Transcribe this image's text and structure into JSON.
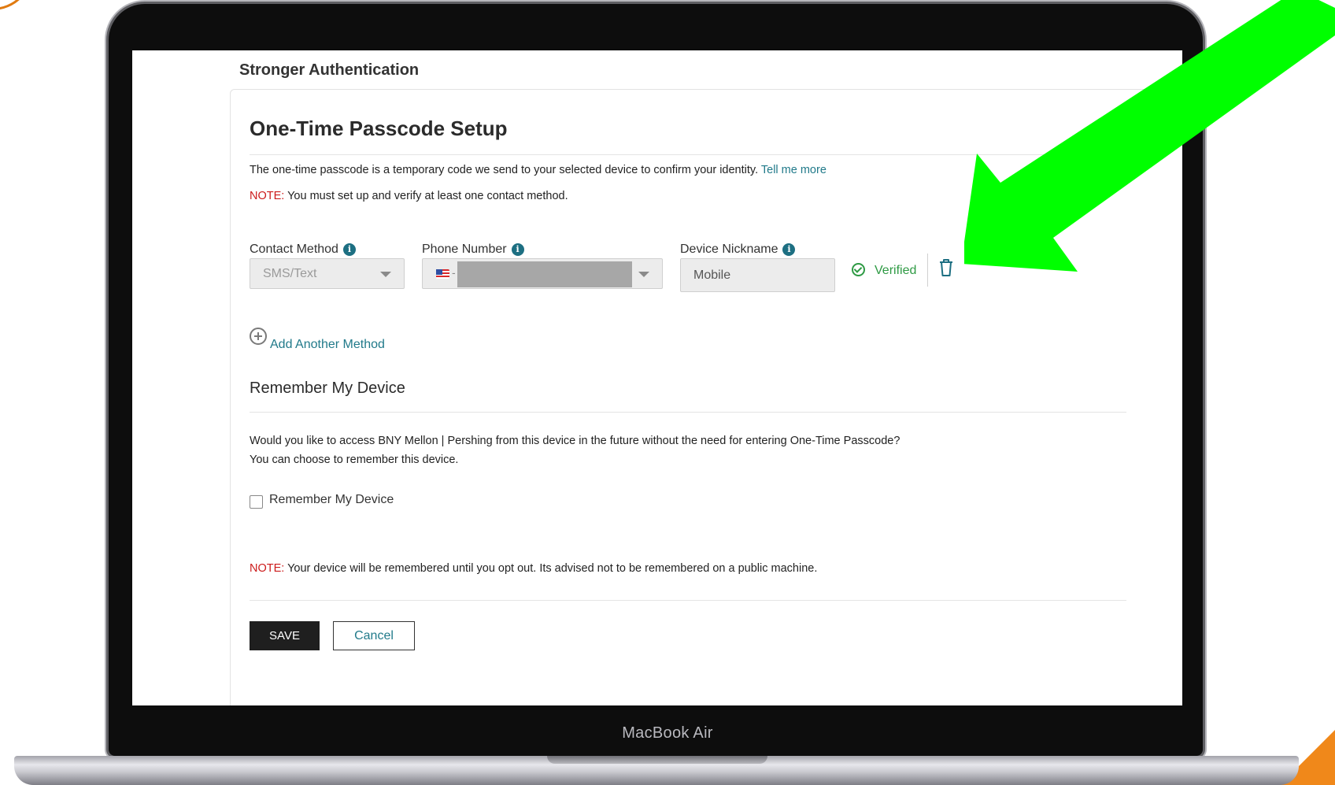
{
  "section_title": "Stronger Authentication",
  "card": {
    "title": "One-Time Passcode Setup",
    "description": "The one-time passcode is a temporary code we send to your selected device to confirm your identity.",
    "tell_me_more": "Tell me more",
    "note_label": "NOTE:",
    "note_text": " You must set up and verify at least one contact method."
  },
  "contact_method": {
    "label": "Contact Method",
    "value": "SMS/Text"
  },
  "phone_number": {
    "label": "Phone Number",
    "dash": "-"
  },
  "device_nickname": {
    "label": "Device Nickname",
    "value": "Mobile"
  },
  "status": {
    "verified": "Verified",
    "color": "#2e9a44"
  },
  "add_method": "Add Another Method",
  "remember": {
    "title": "Remember My Device",
    "question": "Would you like to access BNY Mellon | Pershing from this device in the future without the need for entering One-Time Passcode?",
    "line2": "You can choose to remember this device.",
    "checkbox_label": "Remember My Device",
    "checked": false,
    "note_label": "NOTE:",
    "note_text": " Your device will be remembered until you opt out. Its advised not to be remembered on a public machine."
  },
  "buttons": {
    "save": "SAVE",
    "cancel": "Cancel"
  },
  "laptop": {
    "brand": "MacBook Air"
  },
  "colors": {
    "link": "#217a8a",
    "note": "#cc1b1b",
    "annotation_arrow": "#00ff00"
  },
  "icons": [
    "info-icon",
    "us-flag-icon",
    "chevron-down-icon",
    "check-circle-icon",
    "trash-icon",
    "plus-circle-icon",
    "green-arrow-annotation"
  ]
}
